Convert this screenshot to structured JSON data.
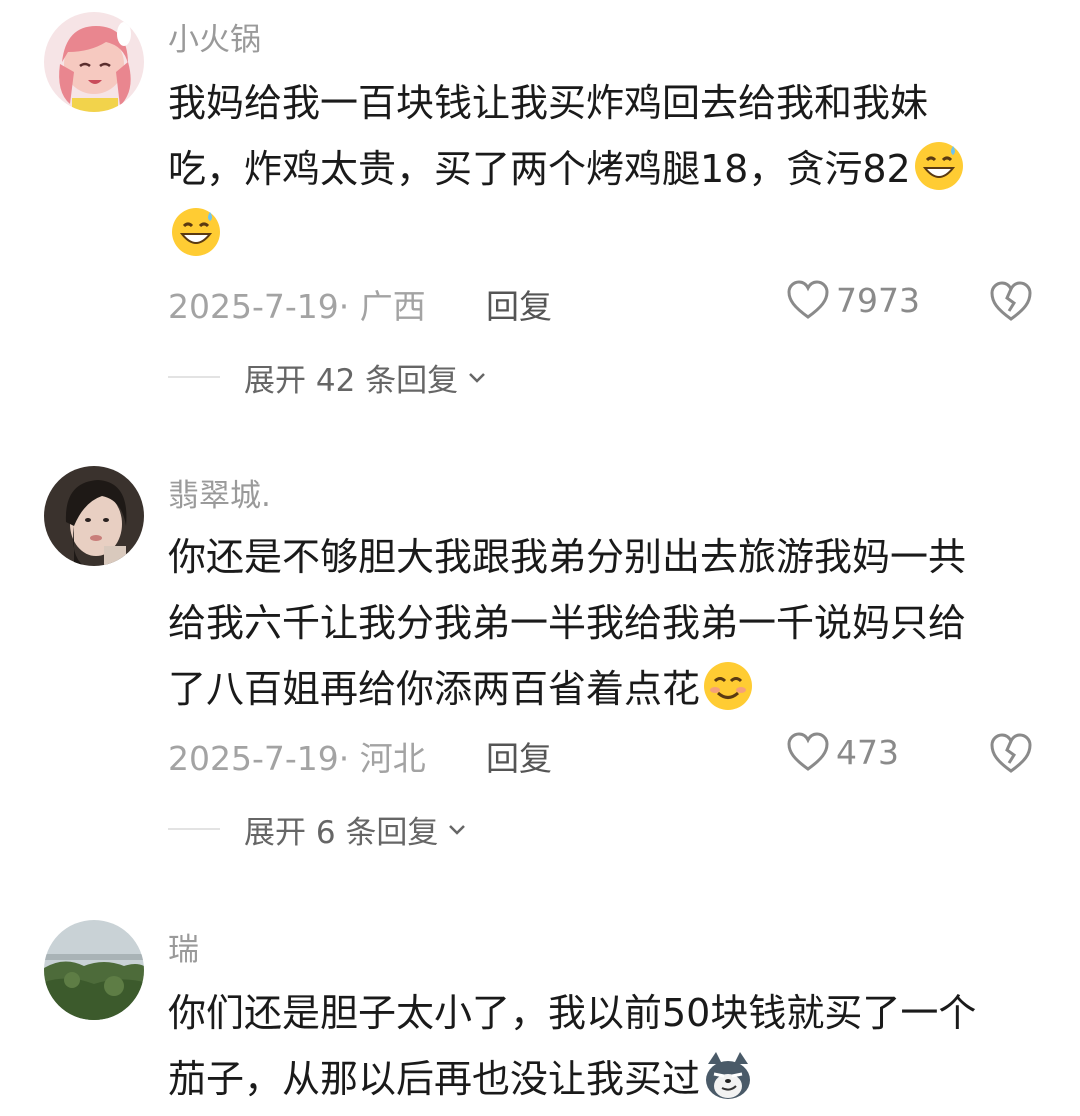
{
  "comments": [
    {
      "username": "小火锅",
      "lines": [
        "我妈给我一百块钱让我买炸鸡回去给我和我妹",
        "吃，炸鸡太贵，买了两个烤鸡腿18，贪污82",
        ""
      ],
      "emojis": [
        "grinning-sweat-emoji",
        "grinning-sweat-emoji"
      ],
      "date_location": "2025-7-19· 广西",
      "reply_label": "回复",
      "likes": "7973",
      "expand_label": "展开 42 条回复"
    },
    {
      "username": "翡翠城.",
      "lines": [
        "你还是不够胆大我跟我弟分别出去旅游我妈一共",
        "给我六千让我分我弟一半我给我弟一千说妈只给",
        "了八百姐再给你添两百省着点花"
      ],
      "emojis": [
        "smiling-emoji"
      ],
      "date_location": "2025-7-19· 河北",
      "reply_label": "回复",
      "likes": "473",
      "expand_label": "展开 6 条回复"
    },
    {
      "username": "瑞",
      "lines": [
        "你们还是胆子太小了，我以前50块钱就买了一个",
        "茄子，从那以后再也没让我买过"
      ],
      "emojis": [
        "smirking-doge-emoji"
      ]
    }
  ],
  "colors": {
    "text": "#1a1a1a",
    "muted": "#9a9a9a",
    "emoji_yellow": "#ffcc33"
  }
}
